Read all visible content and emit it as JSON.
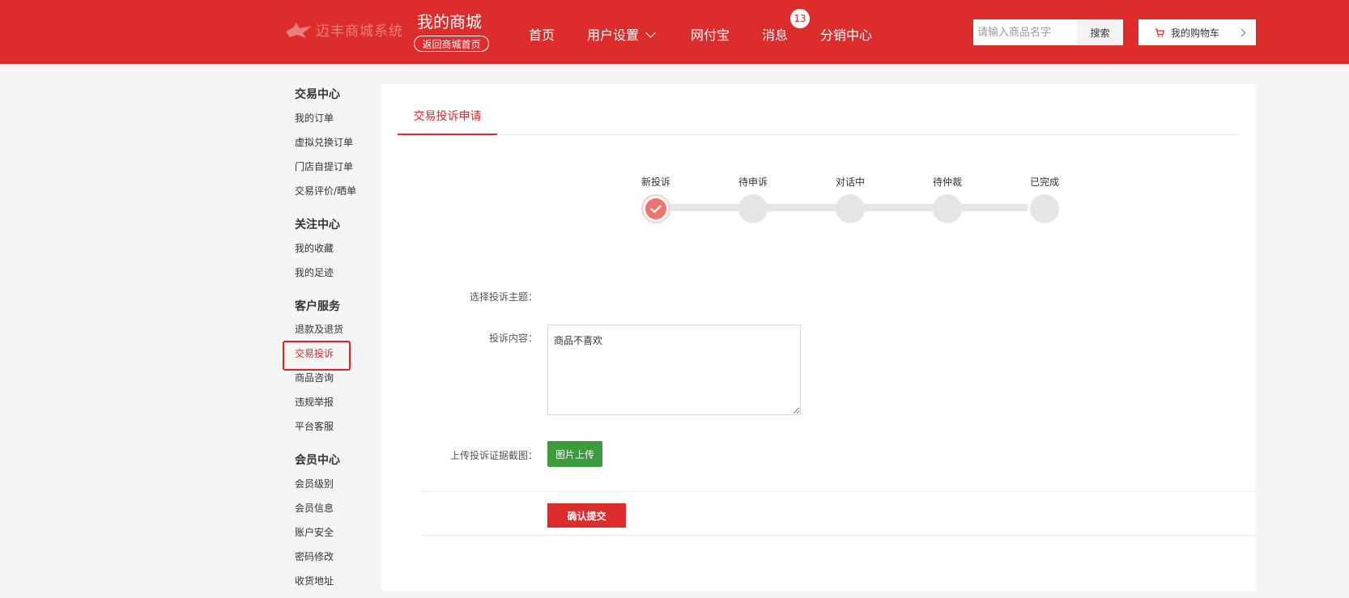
{
  "header": {
    "logo_text": "迈丰商城系统",
    "mall_title": "我的商城",
    "back_label": "返回商城首页",
    "nav": {
      "home": "首页",
      "user_settings": "用户设置",
      "wallet": "网付宝",
      "messages": "消息",
      "distribution": "分销中心"
    },
    "message_count": "13",
    "search_placeholder": "请输入商品名字",
    "search_label": "搜索",
    "cart_label": "我的购物车"
  },
  "sidebar": {
    "groups": [
      {
        "title": "交易中心",
        "items": [
          "我的订单",
          "虚拟兑换订单",
          "门店自提订单",
          "交易评价/晒单"
        ]
      },
      {
        "title": "关注中心",
        "items": [
          "我的收藏",
          "我的足迹"
        ]
      },
      {
        "title": "客户服务",
        "items": [
          "退款及退货",
          "交易投诉",
          "商品咨询",
          "违规举报",
          "平台客服"
        ]
      },
      {
        "title": "会员中心",
        "items": [
          "会员级别",
          "会员信息",
          "账户安全",
          "密码修改",
          "收货地址"
        ]
      }
    ],
    "active_item": "交易投诉"
  },
  "main": {
    "tab_label": "交易投诉申请",
    "steps": [
      "新投诉",
      "待申诉",
      "对话中",
      "待仲裁",
      "已完成"
    ],
    "current_step": 0,
    "form": {
      "subject_label": "选择投诉主题：",
      "content_label": "投诉内容：",
      "content_value": "商品不喜欢",
      "upload_label": "上传投诉证据截图：",
      "upload_button": "图片上传",
      "submit_button": "确认提交"
    }
  },
  "colors": {
    "brand_red": "#dd2c2c",
    "step_done": "#f0736d",
    "upload_green": "#3a9c3d"
  }
}
